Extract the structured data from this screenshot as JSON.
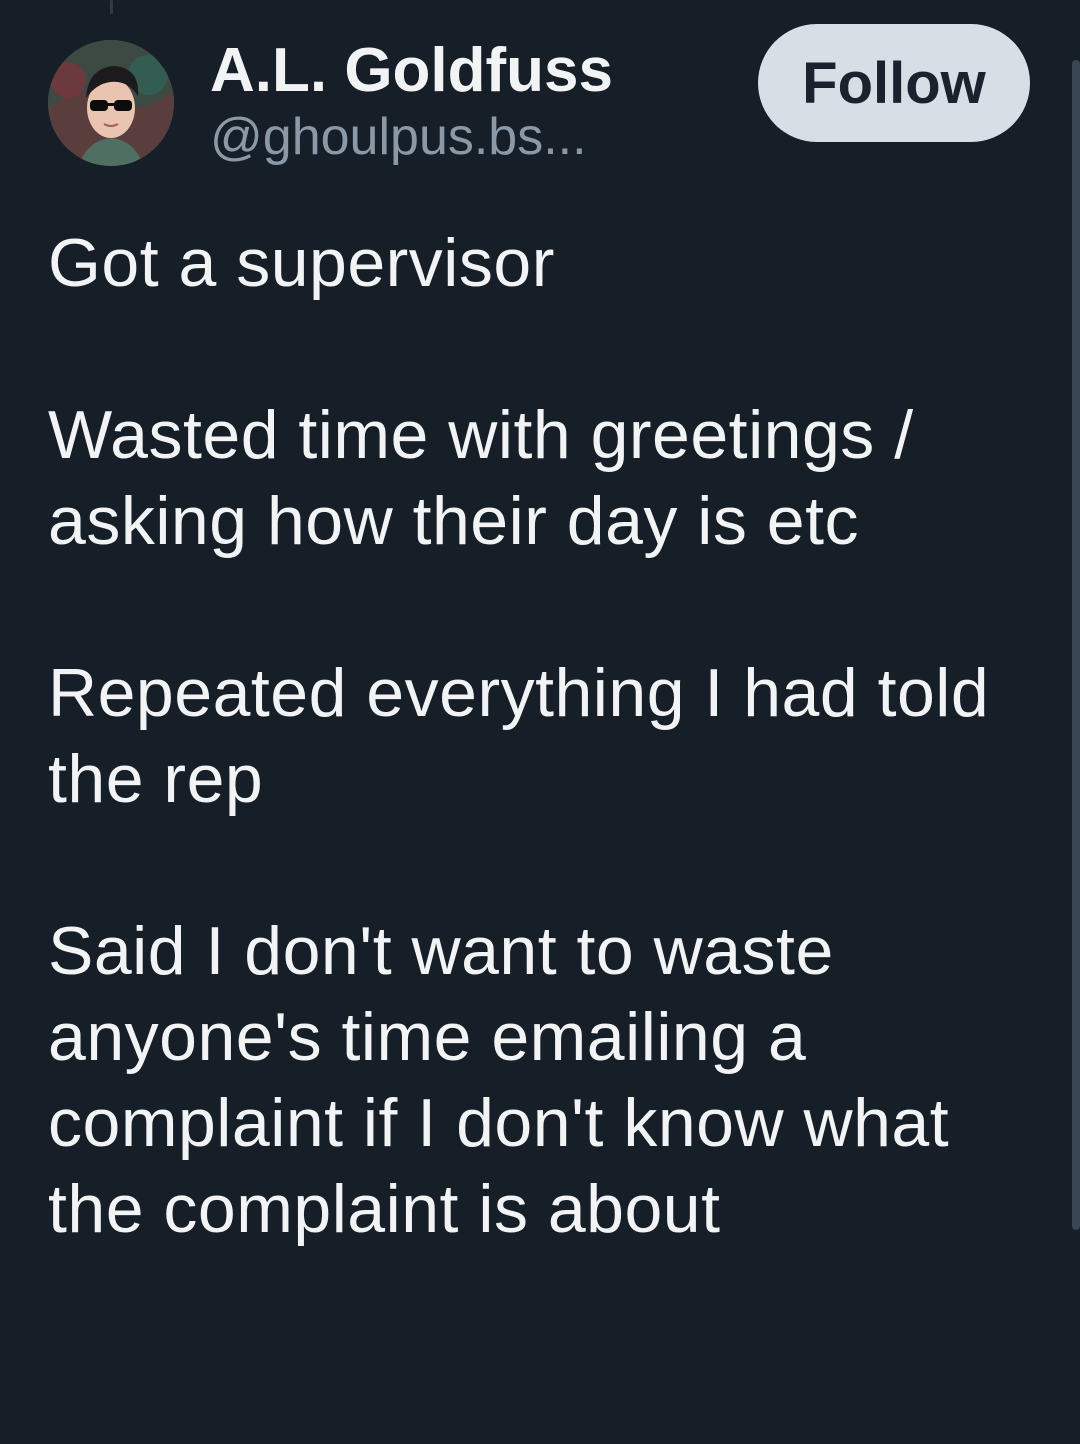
{
  "post": {
    "author": {
      "display_name": "A.L. Goldfuss",
      "handle": "@ghoulpus.bs..."
    },
    "follow_label": "Follow",
    "paragraphs": [
      "Got a supervisor",
      "Wasted time with greetings / asking how their day is etc",
      "Repeated everything I had told the rep",
      "Said I don't want to waste anyone's time emailing a complaint if I don't know what the complaint is about"
    ]
  },
  "colors": {
    "background": "#161e27",
    "text": "#f1f3f5",
    "handle": "#8b98a5",
    "follow_button_bg": "#d8dee6"
  }
}
